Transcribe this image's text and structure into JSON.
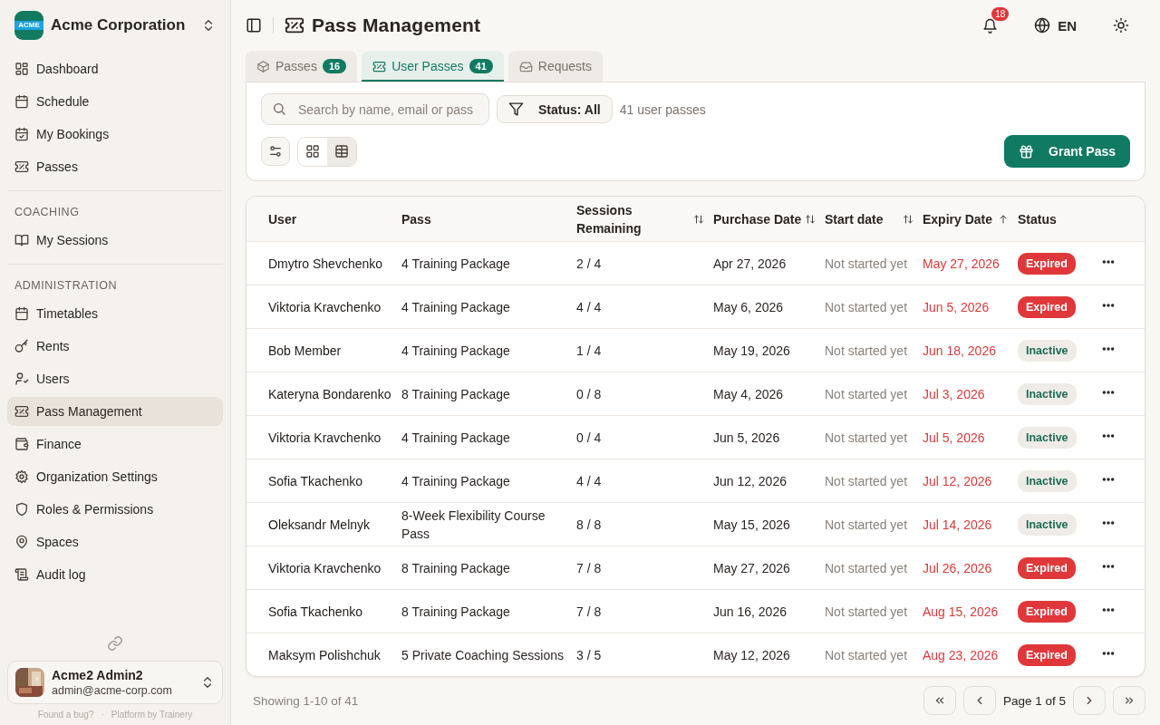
{
  "org": {
    "name": "Acme Corporation",
    "logo_text": "ACME"
  },
  "sidebar": {
    "sections": [
      {
        "items": [
          {
            "label": "Dashboard",
            "selected": false
          },
          {
            "label": "Schedule",
            "selected": false
          },
          {
            "label": "My Bookings",
            "selected": false
          },
          {
            "label": "Passes",
            "selected": false
          }
        ]
      },
      {
        "heading": "COACHING",
        "items": [
          {
            "label": "My Sessions",
            "selected": false
          }
        ]
      },
      {
        "heading": "ADMINISTRATION",
        "items": [
          {
            "label": "Timetables",
            "selected": false
          },
          {
            "label": "Rents",
            "selected": false
          },
          {
            "label": "Users",
            "selected": false
          },
          {
            "label": "Pass Management",
            "selected": true
          },
          {
            "label": "Finance",
            "selected": false
          },
          {
            "label": "Organization Settings",
            "selected": false
          },
          {
            "label": "Roles & Permissions",
            "selected": false
          },
          {
            "label": "Spaces",
            "selected": false
          },
          {
            "label": "Audit log",
            "selected": false
          }
        ]
      }
    ]
  },
  "user": {
    "name": "Acme2 Admin2",
    "email": "admin@acme-corp.com"
  },
  "footer_links": [
    "Found a bug?",
    "·",
    "Platform by Trainery"
  ],
  "header": {
    "title": "Pass Management",
    "notifications": "18",
    "language": "EN"
  },
  "tabs": [
    {
      "label": "Passes",
      "count": "16",
      "selected": false
    },
    {
      "label": "User Passes",
      "count": "41",
      "selected": true
    },
    {
      "label": "Requests",
      "selected": false
    }
  ],
  "toolbar": {
    "search_placeholder": "Search by name, email or pass",
    "filter": "Status: All",
    "result_count": "41 user passes",
    "views": [
      {
        "kind": "grid",
        "selected": false
      },
      {
        "kind": "table",
        "selected": true
      }
    ],
    "grant_button": "Grant Pass"
  },
  "table": {
    "columns": [
      {
        "label": "User",
        "sortable": false,
        "sorted": false
      },
      {
        "label": "Pass",
        "sortable": false,
        "sorted": false
      },
      {
        "label": "Sessions Remaining",
        "sortable": true,
        "sorted": false
      },
      {
        "label": "Purchase Date",
        "sortable": true,
        "sorted": false
      },
      {
        "label": "Start date",
        "sortable": true,
        "sorted": false
      },
      {
        "label": "Expiry Date",
        "sortable": true,
        "sorted": true
      },
      {
        "label": "Status",
        "sortable": false,
        "sorted": false
      }
    ],
    "rows": [
      {
        "user": "Dmytro Shevchenko",
        "pass": "4 Training Package",
        "sessions": "2 / 4",
        "purchase": "Apr 27, 2026",
        "start": "Not started yet",
        "expiry": "May 27, 2026",
        "overdue": true,
        "status": "Expired",
        "kind": "expired"
      },
      {
        "user": "Viktoria Kravchenko",
        "pass": "4 Training Package",
        "sessions": "4 / 4",
        "purchase": "May 6, 2026",
        "start": "Not started yet",
        "expiry": "Jun 5, 2026",
        "overdue": true,
        "status": "Expired",
        "kind": "expired"
      },
      {
        "user": "Bob Member",
        "pass": "4 Training Package",
        "sessions": "1 / 4",
        "purchase": "May 19, 2026",
        "start": "Not started yet",
        "expiry": "Jun 18, 2026",
        "overdue": true,
        "status": "Inactive",
        "kind": "inactive"
      },
      {
        "user": "Kateryna Bondarenko",
        "pass": "8 Training Package",
        "sessions": "0 / 8",
        "purchase": "May 4, 2026",
        "start": "Not started yet",
        "expiry": "Jul 3, 2026",
        "overdue": true,
        "status": "Inactive",
        "kind": "inactive"
      },
      {
        "user": "Viktoria Kravchenko",
        "pass": "4 Training Package",
        "sessions": "0 / 4",
        "purchase": "Jun 5, 2026",
        "start": "Not started yet",
        "expiry": "Jul 5, 2026",
        "overdue": true,
        "status": "Inactive",
        "kind": "inactive"
      },
      {
        "user": "Sofia Tkachenko",
        "pass": "4 Training Package",
        "sessions": "4 / 4",
        "purchase": "Jun 12, 2026",
        "start": "Not started yet",
        "expiry": "Jul 12, 2026",
        "overdue": true,
        "status": "Inactive",
        "kind": "inactive"
      },
      {
        "user": "Oleksandr Melnyk",
        "pass": "8-Week Flexibility Course Pass",
        "sessions": "8 / 8",
        "purchase": "May 15, 2026",
        "start": "Not started yet",
        "expiry": "Jul 14, 2026",
        "overdue": true,
        "status": "Inactive",
        "kind": "inactive"
      },
      {
        "user": "Viktoria Kravchenko",
        "pass": "8 Training Package",
        "sessions": "7 / 8",
        "purchase": "May 27, 2026",
        "start": "Not started yet",
        "expiry": "Jul 26, 2026",
        "overdue": true,
        "status": "Expired",
        "kind": "expired"
      },
      {
        "user": "Sofia Tkachenko",
        "pass": "8 Training Package",
        "sessions": "7 / 8",
        "purchase": "Jun 16, 2026",
        "start": "Not started yet",
        "expiry": "Aug 15, 2026",
        "overdue": true,
        "status": "Expired",
        "kind": "expired"
      },
      {
        "user": "Maksym Polishchuk",
        "pass": "5 Private Coaching Sessions",
        "sessions": "3 / 5",
        "purchase": "May 12, 2026",
        "start": "Not started yet",
        "expiry": "Aug 23, 2026",
        "overdue": true,
        "status": "Expired",
        "kind": "expired"
      }
    ]
  },
  "pagination": {
    "summary": "Showing 1-10 of 41",
    "page": "Page 1 of 5"
  }
}
